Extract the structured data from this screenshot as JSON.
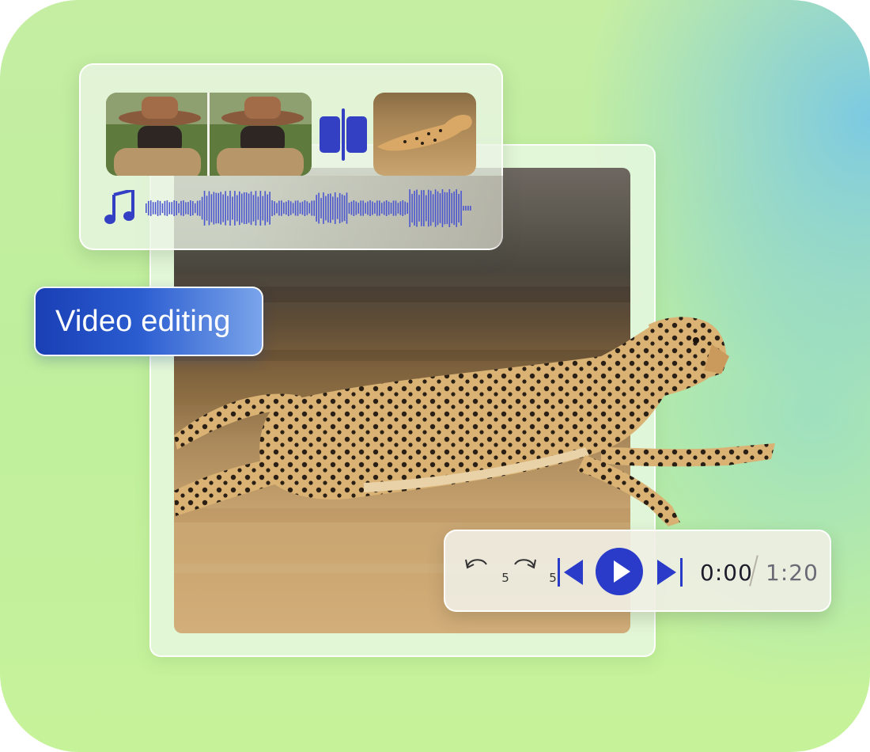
{
  "label": {
    "text": "Video editing"
  },
  "timeline": {
    "clip_1": "photographer-clip",
    "clip_2": "cheetah-clip",
    "split_icon": "split-icon",
    "audio_icon": "music-note-icon"
  },
  "player": {
    "rewind_seconds": "5",
    "forward_seconds": "5",
    "current_time": "0:00",
    "total_time": "1:20",
    "accent_color": "#2a3bc9"
  },
  "colors": {
    "label_gradient_start": "#1a3fb5",
    "label_gradient_end": "#7aa4ea",
    "icon_blue": "#3340c4"
  }
}
